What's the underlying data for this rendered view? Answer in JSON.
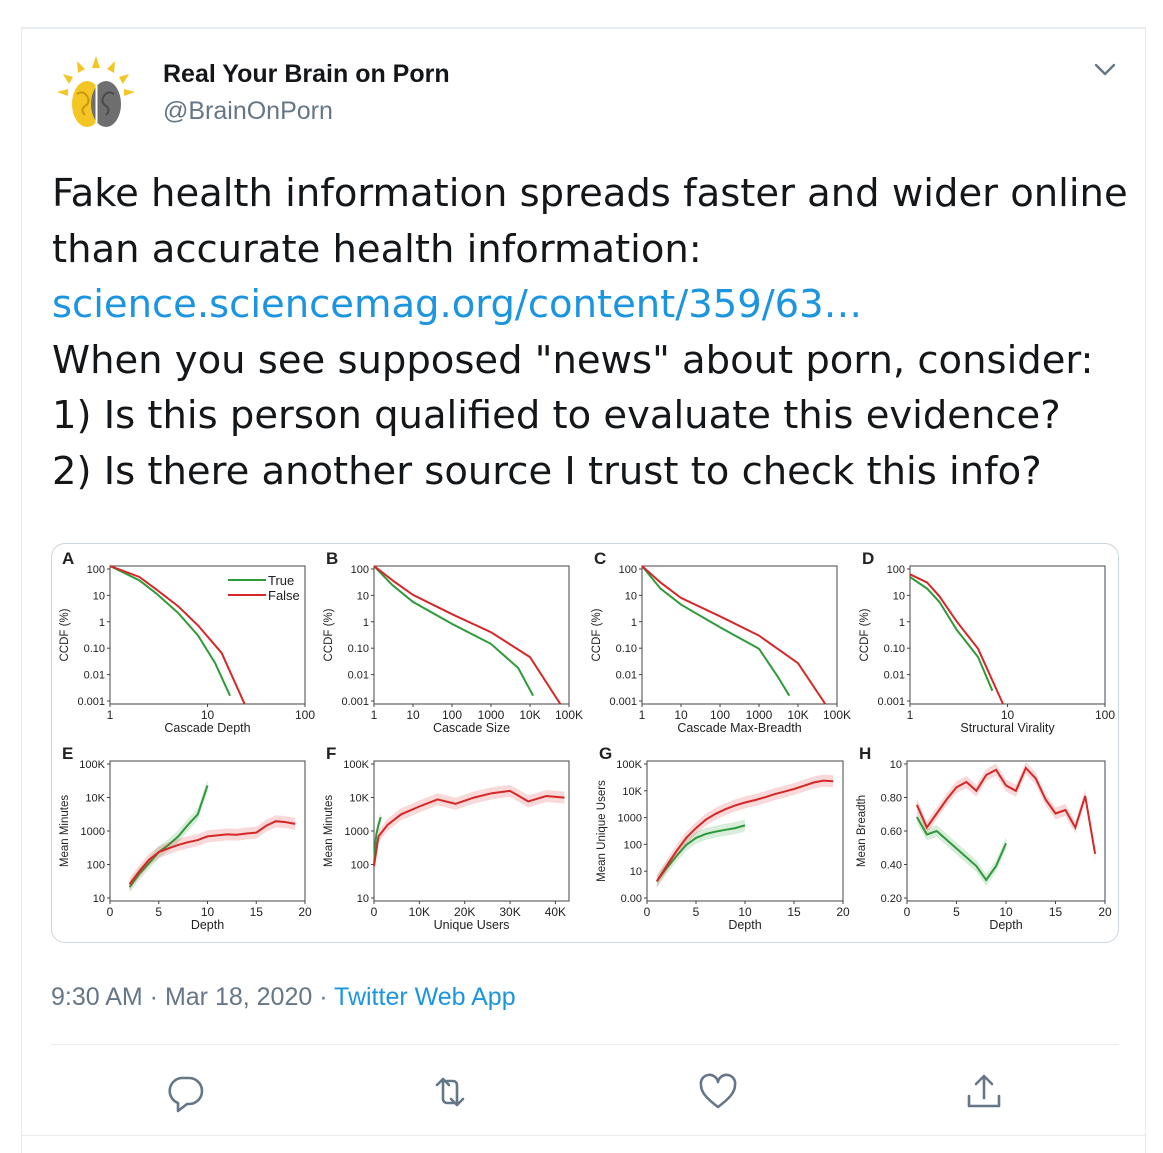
{
  "account": {
    "display_name": "Real Your Brain on Porn",
    "handle": "@BrainOnPorn",
    "avatar_icon": "brain-sun-logo"
  },
  "tweet": {
    "lines": [
      {
        "text": "Fake health information spreads faster and wider online",
        "type": "text"
      },
      {
        "text": "than accurate health information:",
        "type": "text"
      },
      {
        "text": "science.sciencemag.org/content/359/63…",
        "type": "link"
      },
      {
        "text": "When you see supposed \"news\" about porn, consider:",
        "type": "text"
      },
      {
        "text": "1) Is this person qualified to evaluate this evidence?",
        "type": "text"
      },
      {
        "text": "2) Is there another source I trust to check this info?",
        "type": "text"
      }
    ]
  },
  "meta": {
    "time": "9:30 AM",
    "dot1": " · ",
    "date": "Mar 18, 2020",
    "dot2": " · ",
    "app": "Twitter Web App"
  },
  "actions": {
    "reply_icon": "reply-icon",
    "retweet_icon": "retweet-icon",
    "like_icon": "heart-icon",
    "share_icon": "share-icon",
    "menu_icon": "chevron-down-icon"
  },
  "colors": {
    "true_series": "#2e9a3a",
    "false_series": "#d62728",
    "link": "#1b95e0",
    "muted": "#657786"
  },
  "chart_data": [
    {
      "panel": "A",
      "type": "line",
      "xlabel": "Cascade Depth",
      "ylabel": "CCDF (%)",
      "x_scale": "log",
      "y_scale": "log",
      "x_ticks": [
        "1",
        "10",
        "100"
      ],
      "y_ticks": [
        "100",
        "10",
        "1",
        "0.10",
        "0.01",
        "0.001"
      ],
      "legend": [
        "True",
        "False"
      ],
      "legend_position": "top-right",
      "series": [
        {
          "name": "True",
          "x": [
            1,
            2,
            3,
            5,
            8,
            12,
            17
          ],
          "y": [
            100,
            30,
            10,
            2,
            0.3,
            0.03,
            0.002
          ]
        },
        {
          "name": "False",
          "x": [
            1,
            2,
            3,
            5,
            8,
            14,
            24
          ],
          "y": [
            100,
            40,
            14,
            3.5,
            0.7,
            0.07,
            0.001
          ]
        }
      ]
    },
    {
      "panel": "B",
      "type": "line",
      "xlabel": "Cascade Size",
      "ylabel": "CCDF (%)",
      "x_scale": "log",
      "y_scale": "log",
      "x_ticks": [
        "1",
        "10",
        "100",
        "1000",
        "10K",
        "100K"
      ],
      "y_ticks": [
        "100",
        "10",
        "1",
        "0.10",
        "0.01",
        "0.001"
      ],
      "series": [
        {
          "name": "True",
          "x": [
            1,
            3,
            10,
            100,
            1000,
            5000,
            12000
          ],
          "y": [
            100,
            20,
            5,
            0.8,
            0.15,
            0.02,
            0.002
          ]
        },
        {
          "name": "False",
          "x": [
            1,
            3,
            10,
            100,
            1000,
            10000,
            60000
          ],
          "y": [
            100,
            30,
            9,
            1.8,
            0.4,
            0.05,
            0.001
          ]
        }
      ]
    },
    {
      "panel": "C",
      "type": "line",
      "xlabel": "Cascade Max-Breadth",
      "ylabel": "CCDF (%)",
      "x_scale": "log",
      "y_scale": "log",
      "x_ticks": [
        "1",
        "10",
        "100",
        "1000",
        "10K",
        "100K"
      ],
      "y_ticks": [
        "100",
        "10",
        "1",
        "0.10",
        "0.01",
        "0.001"
      ],
      "series": [
        {
          "name": "True",
          "x": [
            1,
            3,
            10,
            100,
            1000,
            3000,
            6000
          ],
          "y": [
            100,
            15,
            4,
            0.6,
            0.1,
            0.01,
            0.002
          ]
        },
        {
          "name": "False",
          "x": [
            1,
            3,
            10,
            100,
            1000,
            10000,
            50000
          ],
          "y": [
            100,
            25,
            7,
            1.5,
            0.3,
            0.03,
            0.001
          ]
        }
      ]
    },
    {
      "panel": "D",
      "type": "line",
      "xlabel": "Structural Virality",
      "ylabel": "CCDF (%)",
      "x_scale": "log",
      "y_scale": "log",
      "x_ticks": [
        "1",
        "10",
        "100"
      ],
      "y_ticks": [
        "100",
        "10",
        "1",
        "0.10",
        "0.01",
        "0.001"
      ],
      "series": [
        {
          "name": "True",
          "x": [
            1,
            1.5,
            2,
            3,
            5,
            7
          ],
          "y": [
            40,
            15,
            5,
            0.5,
            0.05,
            0.003
          ]
        },
        {
          "name": "False",
          "x": [
            1,
            1.5,
            2,
            3,
            5,
            9
          ],
          "y": [
            50,
            25,
            8,
            1,
            0.1,
            0.001
          ]
        }
      ]
    },
    {
      "panel": "E",
      "type": "line",
      "xlabel": "Depth",
      "ylabel": "Mean Minutes",
      "y_scale": "log",
      "xlim": [
        0,
        20
      ],
      "x_ticks": [
        "0",
        "5",
        "10",
        "15",
        "20"
      ],
      "y_ticks": [
        "100K",
        "10K",
        "1000",
        "100",
        "10"
      ],
      "series": [
        {
          "name": "True",
          "x": [
            2,
            3,
            4,
            5,
            6,
            7,
            8,
            9,
            10
          ],
          "y": [
            25,
            60,
            120,
            250,
            400,
            700,
            1500,
            3000,
            20000
          ]
        },
        {
          "name": "False",
          "x": [
            2,
            3,
            4,
            5,
            6,
            7,
            8,
            9,
            10,
            11,
            12,
            13,
            14,
            15,
            16,
            17,
            18,
            19
          ],
          "y": [
            30,
            70,
            150,
            250,
            320,
            400,
            480,
            550,
            700,
            750,
            800,
            780,
            850,
            900,
            1400,
            1900,
            1800,
            1600
          ]
        }
      ]
    },
    {
      "panel": "F",
      "type": "line",
      "xlabel": "Unique Users",
      "ylabel": "Mean Minutes",
      "y_scale": "log",
      "xlim": [
        0,
        43000
      ],
      "x_ticks": [
        "0",
        "10K",
        "20K",
        "30K",
        "40K"
      ],
      "y_ticks": [
        "100K",
        "10K",
        "1000",
        "100",
        "10"
      ],
      "series": [
        {
          "name": "True",
          "x": [
            0,
            200,
            500,
            1000,
            1500
          ],
          "y": [
            100,
            300,
            800,
            1500,
            2500
          ]
        },
        {
          "name": "False",
          "x": [
            0,
            1000,
            3000,
            6000,
            10000,
            14000,
            18000,
            22000,
            26000,
            30000,
            34000,
            38000,
            42000
          ],
          "y": [
            100,
            700,
            1500,
            3000,
            5000,
            8000,
            6000,
            9000,
            12000,
            14000,
            7000,
            10000,
            9000
          ]
        }
      ]
    },
    {
      "panel": "G",
      "type": "line",
      "xlabel": "Depth",
      "ylabel": "Mean Unique Users",
      "y_scale": "log",
      "xlim": [
        0,
        20
      ],
      "x_ticks": [
        "0",
        "5",
        "10",
        "15",
        "20"
      ],
      "y_ticks": [
        "100K",
        "10K",
        "1000",
        "100",
        "10",
        "0.00"
      ],
      "series": [
        {
          "name": "True",
          "x": [
            1,
            2,
            3,
            4,
            5,
            6,
            7,
            8,
            9,
            10
          ],
          "y": [
            5,
            15,
            40,
            100,
            180,
            250,
            300,
            350,
            400,
            500
          ]
        },
        {
          "name": "False",
          "x": [
            1,
            2,
            3,
            4,
            5,
            6,
            7,
            8,
            9,
            10,
            11,
            12,
            13,
            14,
            15,
            16,
            17,
            18,
            19
          ],
          "y": [
            5,
            18,
            60,
            180,
            400,
            800,
            1300,
            1900,
            2600,
            3300,
            4000,
            5000,
            6500,
            8000,
            10000,
            13000,
            17000,
            20000,
            19000
          ]
        }
      ]
    },
    {
      "panel": "H",
      "type": "line",
      "xlabel": "Depth",
      "ylabel": "Mean Breadth",
      "xlim": [
        0,
        20
      ],
      "x_ticks": [
        "0",
        "5",
        "10",
        "15",
        "20"
      ],
      "y_ticks": [
        "10",
        "0.80",
        "0.60",
        "0.40",
        "0.20"
      ],
      "series": [
        {
          "name": "True",
          "x": [
            1,
            2,
            3,
            4,
            5,
            6,
            7,
            8,
            9,
            10
          ],
          "y": [
            0.68,
            0.58,
            0.6,
            0.55,
            0.5,
            0.45,
            0.4,
            0.32,
            0.4,
            0.53
          ]
        },
        {
          "name": "False",
          "x": [
            1,
            2,
            3,
            4,
            5,
            6,
            7,
            8,
            9,
            10,
            11,
            12,
            13,
            14,
            15,
            16,
            17,
            18,
            19
          ],
          "y": [
            0.75,
            0.62,
            0.7,
            0.78,
            0.85,
            0.88,
            0.83,
            0.92,
            0.95,
            0.86,
            0.83,
            0.96,
            0.9,
            0.78,
            0.7,
            0.72,
            0.62,
            0.8,
            0.47
          ]
        }
      ]
    }
  ]
}
